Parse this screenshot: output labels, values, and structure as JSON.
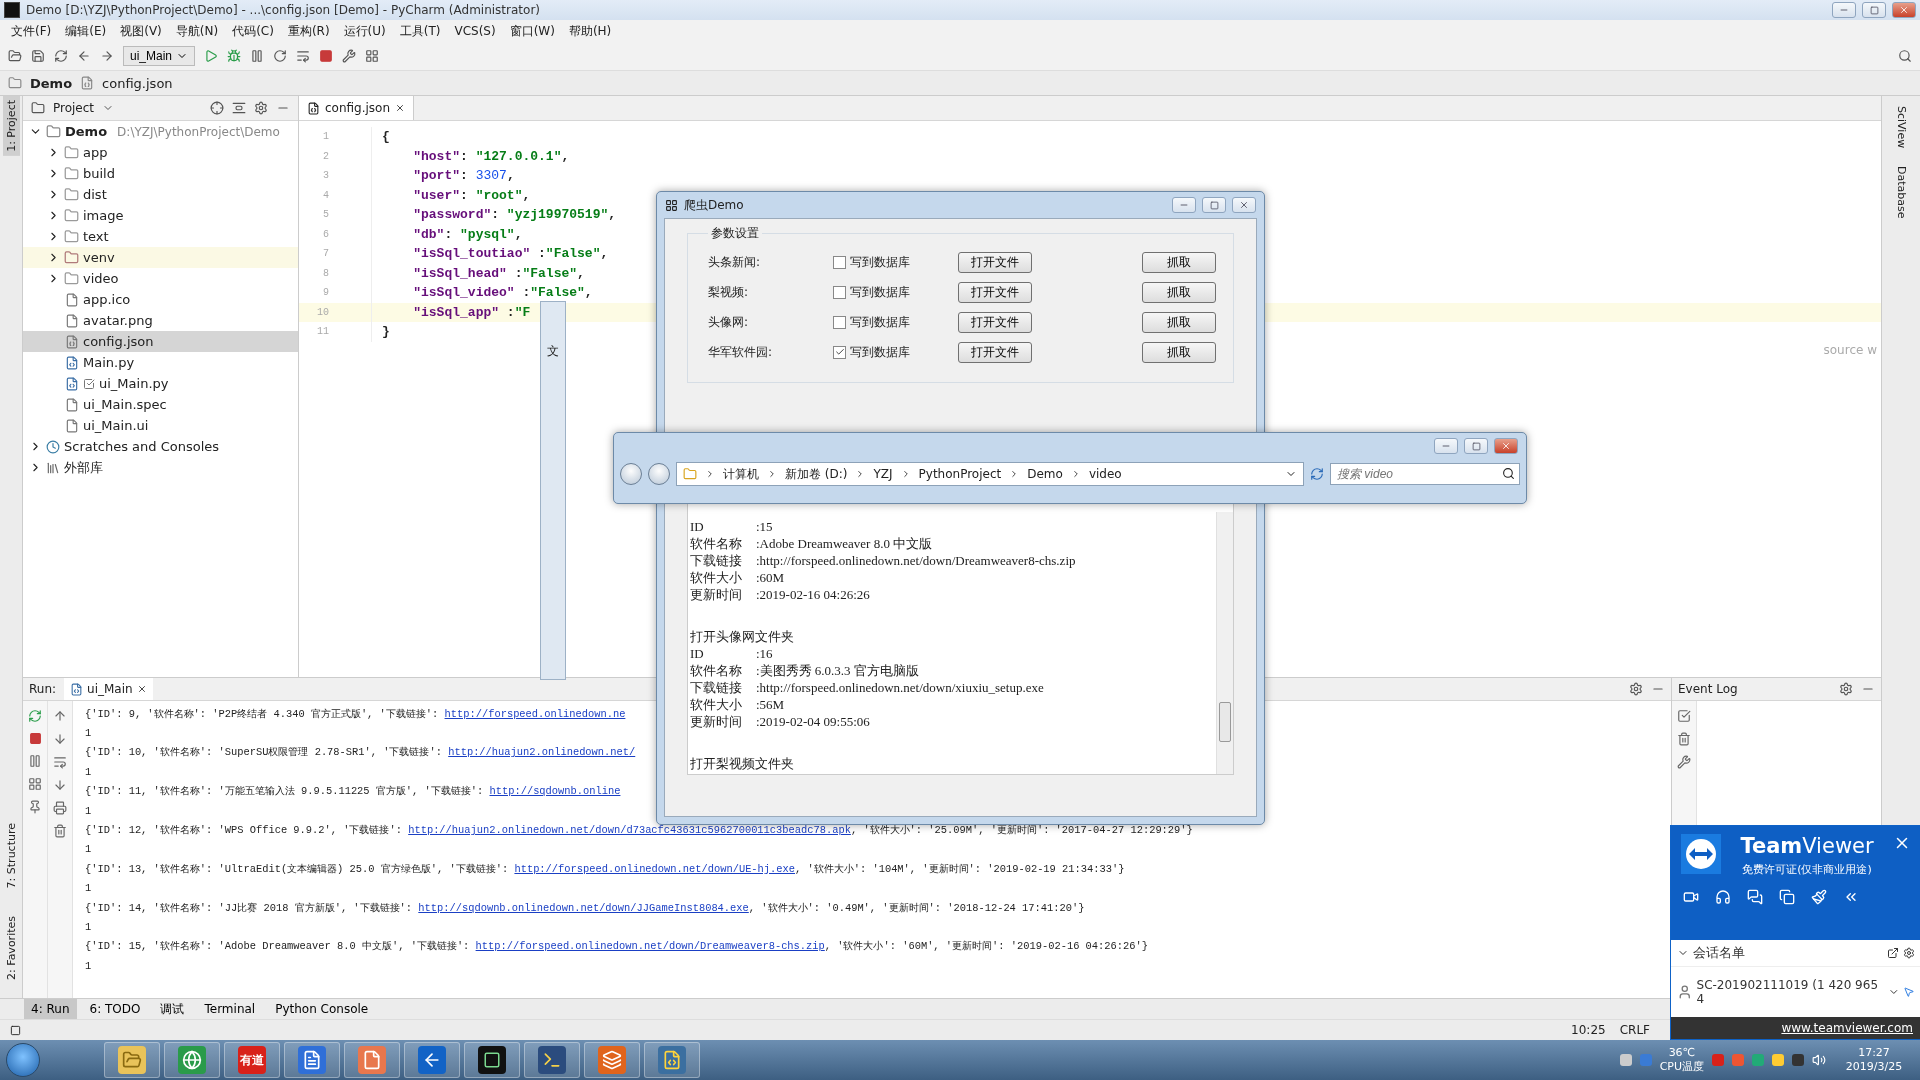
{
  "window": {
    "title": "Demo [D:\\YZJ\\PythonProject\\Demo] - ...\\config.json [Demo] - PyCharm (Administrator)"
  },
  "menu": [
    "文件(F)",
    "编辑(E)",
    "视图(V)",
    "导航(N)",
    "代码(C)",
    "重构(R)",
    "运行(U)",
    "工具(T)",
    "VCS(S)",
    "窗口(W)",
    "帮助(H)"
  ],
  "toolbar": {
    "run_config": "ui_Main"
  },
  "breadcrumbs": [
    "Demo",
    "config.json"
  ],
  "side_tabs_left": [
    {
      "label": "1: Project",
      "selected": true
    },
    {
      "label": "7: Structure",
      "selected": false
    },
    {
      "label": "2: Favorites",
      "selected": false
    }
  ],
  "side_tabs_right": [
    "SciView",
    "Database"
  ],
  "project": {
    "title": "Project",
    "tree": [
      {
        "name": "Demo",
        "path": "D:\\YZJ\\PythonProject\\Demo",
        "kind": "root",
        "expanded": true,
        "selected": false,
        "children": [
          {
            "name": "app",
            "kind": "folder",
            "expanded": false,
            "selected": false
          },
          {
            "name": "build",
            "kind": "folder",
            "expanded": false,
            "selected": false
          },
          {
            "name": "dist",
            "kind": "folder",
            "expanded": false,
            "selected": false
          },
          {
            "name": "image",
            "kind": "folder",
            "expanded": false,
            "selected": false
          },
          {
            "name": "text",
            "kind": "folder",
            "expanded": false,
            "selected": false
          },
          {
            "name": "venv",
            "kind": "excluded",
            "expanded": false,
            "selected": false
          },
          {
            "name": "video",
            "kind": "folder",
            "expanded": false,
            "selected": false
          },
          {
            "name": "app.ico",
            "kind": "file",
            "selected": false
          },
          {
            "name": "avatar.png",
            "kind": "file",
            "selected": false
          },
          {
            "name": "config.json",
            "kind": "json",
            "selected": true
          },
          {
            "name": "Main.py",
            "kind": "python",
            "selected": false
          },
          {
            "name": "ui_Main.py",
            "kind": "python_checked",
            "selected": false
          },
          {
            "name": "ui_Main.spec",
            "kind": "file",
            "selected": false
          },
          {
            "name": "ui_Main.ui",
            "kind": "file",
            "selected": false
          }
        ]
      },
      {
        "name": "Scratches and Consoles",
        "kind": "scratches",
        "expanded": false,
        "selected": false
      },
      {
        "name": "外部库",
        "kind": "library",
        "expanded": false,
        "selected": false
      }
    ]
  },
  "editor": {
    "tab": "config.json",
    "side_text": "source w",
    "lines": [
      {
        "number": "1",
        "text": "{",
        "current": false
      },
      {
        "number": "2",
        "text": "    \"host\": \"127.0.0.1\",",
        "current": false
      },
      {
        "number": "3",
        "text": "    \"port\": 3307,",
        "current": false
      },
      {
        "number": "4",
        "text": "    \"user\": \"root\",",
        "current": false
      },
      {
        "number": "5",
        "text": "    \"password\": \"yzj19970519\",",
        "current": false
      },
      {
        "number": "6",
        "text": "    \"db\": \"pysql\",",
        "current": false
      },
      {
        "number": "7",
        "text": "    \"isSql_toutiao\" :\"False\",",
        "current": false
      },
      {
        "number": "8",
        "text": "    \"isSql_head\" :\"False\",",
        "current": false
      },
      {
        "number": "9",
        "text": "    \"isSql_video\" :\"False\",",
        "current": false
      },
      {
        "number": "10",
        "text": "    \"isSql_app\" :\"F",
        "current": true
      },
      {
        "number": "11",
        "text": "}",
        "current": false
      }
    ]
  },
  "ghost_window": {
    "label": "文"
  },
  "dialog": {
    "title": "爬虫Demo",
    "group": "参数设置",
    "rows": [
      {
        "label": "头条新闻:",
        "checkbox": "写到数据库",
        "checked": false,
        "open_button": "打开文件",
        "fetch_button": "抓取"
      },
      {
        "label": "梨视频:",
        "checkbox": "写到数据库",
        "checked": false,
        "open_button": "打开文件",
        "fetch_button": "抓取"
      },
      {
        "label": "头像网:",
        "checkbox": "写到数据库",
        "checked": false,
        "open_button": "打开文件",
        "fetch_button": "抓取"
      },
      {
        "label": "华军软件园:",
        "checkbox": "写到数据库",
        "checked": true,
        "open_button": "打开文件",
        "fetch_button": "抓取"
      }
    ],
    "output": [
      {
        "fields": [
          {
            "label": "ID",
            "value": ":15"
          },
          {
            "label": "软件名称",
            "value": ":Adobe Dreamweaver 8.0 中文版"
          },
          {
            "label": "下载链接",
            "value": ":http://forspeed.onlinedown.net/down/Dreamweaver8-chs.zip"
          },
          {
            "label": "软件大小",
            "value": ":60M"
          },
          {
            "label": "更新时间",
            "value": ":2019-02-16 04:26:26"
          }
        ]
      },
      {
        "heading": "打开头像网文件夹",
        "fields": [
          {
            "label": "ID",
            "value": ":16"
          },
          {
            "label": "软件名称",
            "value": ":美图秀秀 6.0.3.3 官方电脑版"
          },
          {
            "label": "下载链接",
            "value": ":http://forspeed.onlinedown.net/down/xiuxiu_setup.exe"
          },
          {
            "label": "软件大小",
            "value": ":56M"
          },
          {
            "label": "更新时间",
            "value": ":2019-02-04 09:55:06"
          }
        ]
      },
      {
        "heading": "打开梨视频文件夹"
      }
    ]
  },
  "explorer": {
    "path": [
      "计算机",
      "新加卷 (D:)",
      "YZJ",
      "PythonProject",
      "Demo",
      "video"
    ],
    "search": {
      "placeholder": "搜索 video"
    }
  },
  "run": {
    "title": "Run:",
    "tab": "ui_Main",
    "lines": [
      {
        "kind": "record",
        "prefix": "{'ID': 9, '软件名称': 'P2P终结者 4.340 官方正式版', '下载链接': ",
        "link": "http://forspeed.onlinedown.ne"
      },
      {
        "kind": "plain",
        "text": "1"
      },
      {
        "kind": "record",
        "prefix": "{'ID': 10, '软件名称': 'SuperSU权限管理 2.78-SR1', '下载链接': ",
        "link": "http://huajun2.onlinedown.net/"
      },
      {
        "kind": "plain",
        "text": "1"
      },
      {
        "kind": "record",
        "prefix": "{'ID': 11, '软件名称': '万能五笔输入法 9.9.5.11225 官方版', '下载链接': ",
        "link": "http://sqdownb.online"
      },
      {
        "kind": "plain",
        "text": "1"
      },
      {
        "kind": "record",
        "prefix": "{'ID': 12, '软件名称': 'WPS Office 9.9.2', '下载链接': ",
        "link": "http://huajun2.onlinedown.net/down/d73acfc43631c5962700011c3beadc78.apk",
        "suffix": ", '软件大小': '25.09M', '更新时间': '2017-04-27 12:29:29'}"
      },
      {
        "kind": "plain",
        "text": "1"
      },
      {
        "kind": "record",
        "prefix": "{'ID': 13, '软件名称': 'UltraEdit(文本编辑器) 25.0 官方绿色版', '下载链接': ",
        "link": "http://forspeed.onlinedown.net/down/UE-hj.exe",
        "suffix": ", '软件大小': '104M', '更新时间': '2019-02-19 21:34:33'}"
      },
      {
        "kind": "plain",
        "text": "1"
      },
      {
        "kind": "record",
        "prefix": "{'ID': 14, '软件名称': 'JJ比赛 2018 官方新版', '下载链接': ",
        "link": "http://sqdownb.onlinedown.net/down/JJGameInst8084.exe",
        "suffix": ", '软件大小': '0.49M', '更新时间': '2018-12-24 17:41:20'}"
      },
      {
        "kind": "plain",
        "text": "1"
      },
      {
        "kind": "record",
        "prefix": "{'ID': 15, '软件名称': 'Adobe Dreamweaver 8.0 中文版', '下载链接': ",
        "link": "http://forspeed.onlinedown.net/down/Dreamweaver8-chs.zip",
        "suffix": ", '软件大小': '60M', '更新时间': '2019-02-16 04:26:26'}"
      },
      {
        "kind": "plain",
        "text": "1"
      }
    ]
  },
  "event_log": {
    "title": "Event Log"
  },
  "bottom_tabs": [
    {
      "label": "4: Run",
      "selected": true
    },
    {
      "label": "6: TODO",
      "selected": false
    },
    {
      "label": "调试",
      "selected": false
    },
    {
      "label": "Terminal",
      "selected": false
    },
    {
      "label": "Python Console",
      "selected": false
    }
  ],
  "status_bar": {
    "position": "10:25",
    "line_ending": "CRLF"
  },
  "teamviewer": {
    "brand": "**Team**Viewer",
    "subtitle": "免费许可证(仅非商业用途)",
    "section": "会话名单",
    "session": "SC-201902111019 (1 420 965 4",
    "link": "www.teamviewer.com"
  },
  "taskbar": {
    "apps": [
      {
        "kind": "folder"
      },
      {
        "kind": "browser"
      },
      {
        "kind": "label",
        "label": "有道"
      },
      {
        "kind": "w"
      },
      {
        "kind": "document"
      },
      {
        "kind": "remote"
      },
      {
        "kind": "ide"
      },
      {
        "kind": "terminal"
      },
      {
        "kind": "mask"
      },
      {
        "kind": "python"
      }
    ],
    "temperature": "36℃",
    "temperature_label": "CPU温度",
    "time": "17:27",
    "date": "2019/3/25"
  }
}
